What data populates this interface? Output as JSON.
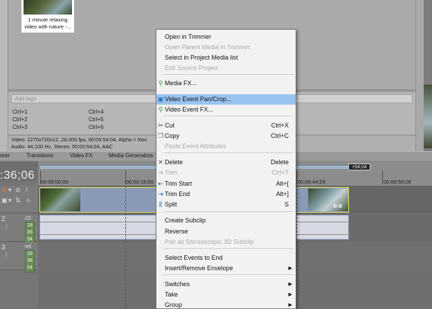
{
  "media": {
    "thumb_caption_line1": "1 minute relaxing",
    "thumb_caption_line2": "video with nature -..."
  },
  "tags": {
    "placeholder": "Add tags",
    "cells": [
      "Ctrl+1",
      "Ctrl+2",
      "Ctrl+3",
      "Ctrl+4",
      "Ctrl+5",
      "Ctrl+6"
    ]
  },
  "info": {
    "video_line": "Video: 1270x720x12, 26.000 fps, 00:00:54;04, Alpha = Non",
    "audio_line": "Audio: 44,100 Hz, Stereo, 00:00:54;04, AAC"
  },
  "tabs": [
    "orer",
    "Transitions",
    "Video FX",
    "Media Generators"
  ],
  "timeline": {
    "time_display": ":36;06",
    "loop_end_label": "+54;04",
    "ruler_marks": [
      "00:00:00;00",
      "00:00:15;00",
      "00:00:44;29",
      "00:00:59;28"
    ],
    "video_track_number": "1",
    "audio_track_number": "2",
    "empty_track_number": "3",
    "audio_volume": "-22",
    "empty_volume": "-Inf.",
    "meter_values": [
      "18",
      "36",
      "54"
    ]
  },
  "context_menu": {
    "items": [
      {
        "label": "Open in Trimmer",
        "shortcut": "",
        "disabled": false,
        "highlight": false,
        "icon": ""
      },
      {
        "label": "Open Parent Media in Trimmer",
        "shortcut": "",
        "disabled": true,
        "highlight": false,
        "icon": ""
      },
      {
        "label": "Select in Project Media list",
        "shortcut": "",
        "disabled": false,
        "highlight": false,
        "icon": ""
      },
      {
        "label": "Edit Source Project",
        "shortcut": "",
        "disabled": true,
        "highlight": false,
        "icon": ""
      },
      {
        "label": "Media FX...",
        "shortcut": "",
        "disabled": false,
        "highlight": false,
        "icon": "fx-plug-icon"
      },
      {
        "label": "Video Event Pan/Crop...",
        "shortcut": "",
        "disabled": false,
        "highlight": true,
        "icon": "pan-crop-icon"
      },
      {
        "label": "Video Event FX...",
        "shortcut": "",
        "disabled": false,
        "highlight": false,
        "icon": "fx-plug-icon"
      },
      {
        "label": "Cut",
        "shortcut": "Ctrl+X",
        "disabled": false,
        "highlight": false,
        "icon": "scissors-icon"
      },
      {
        "label": "Copy",
        "shortcut": "Ctrl+C",
        "disabled": false,
        "highlight": false,
        "icon": "copy-icon"
      },
      {
        "label": "Paste Event Attributes",
        "shortcut": "",
        "disabled": true,
        "highlight": false,
        "icon": ""
      },
      {
        "label": "Delete",
        "shortcut": "Delete",
        "disabled": false,
        "highlight": false,
        "icon": "delete-icon"
      },
      {
        "label": "Trim",
        "shortcut": "Ctrl+T",
        "disabled": true,
        "highlight": false,
        "icon": "trim-icon"
      },
      {
        "label": "Trim Start",
        "shortcut": "Alt+[",
        "disabled": false,
        "highlight": false,
        "icon": "trim-start-icon"
      },
      {
        "label": "Trim End",
        "shortcut": "Alt+]",
        "disabled": false,
        "highlight": false,
        "icon": "trim-end-icon"
      },
      {
        "label": "Split",
        "shortcut": "S",
        "disabled": false,
        "highlight": false,
        "icon": "split-icon"
      },
      {
        "label": "Create Subclip",
        "shortcut": "",
        "disabled": false,
        "highlight": false,
        "icon": ""
      },
      {
        "label": "Reverse",
        "shortcut": "",
        "disabled": false,
        "highlight": false,
        "icon": ""
      },
      {
        "label": "Pair as Stereoscopic 3D Subclip",
        "shortcut": "",
        "disabled": true,
        "highlight": false,
        "icon": ""
      },
      {
        "label": "Select Events to End",
        "shortcut": "",
        "disabled": false,
        "highlight": false,
        "icon": ""
      },
      {
        "label": "Insert/Remove Envelope",
        "shortcut": "",
        "disabled": false,
        "highlight": false,
        "icon": "",
        "submenu": true
      },
      {
        "label": "Switches",
        "shortcut": "",
        "disabled": false,
        "highlight": false,
        "icon": "",
        "submenu": true
      },
      {
        "label": "Take",
        "shortcut": "",
        "disabled": false,
        "highlight": false,
        "icon": "",
        "submenu": true
      },
      {
        "label": "Group",
        "shortcut": "",
        "disabled": false,
        "highlight": false,
        "icon": "",
        "submenu": true
      }
    ]
  }
}
